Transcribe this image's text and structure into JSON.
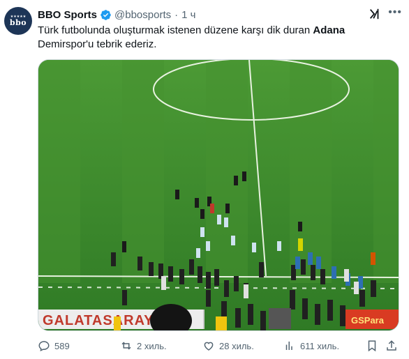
{
  "author": {
    "name": "BBO Sports",
    "handle": "@bbosports",
    "separator": "·",
    "time": "1 ч",
    "avatar_stars": "★★★★★",
    "avatar_text": "bbo"
  },
  "tweet": {
    "text_part1": "Türk futbolunda oluşturmak istenen düzene karşı dik duran ",
    "text_bold": "Adana",
    "text_part2": "Demirspor'u tebrik ederiz."
  },
  "media": {
    "banner_left": "GALATASARAY",
    "banner_right": "GSPara"
  },
  "actions": {
    "replies": "589",
    "reposts": "2 хиль.",
    "likes": "28 хиль.",
    "views": "611 хиль."
  },
  "icons": [
    "verified-icon",
    "grok-icon",
    "more-icon",
    "reply-icon",
    "repost-icon",
    "like-icon",
    "views-icon",
    "bookmark-icon",
    "share-icon"
  ],
  "colors": {
    "verified": "#1d9bf0",
    "muted": "#536471",
    "text": "#0f1419"
  }
}
